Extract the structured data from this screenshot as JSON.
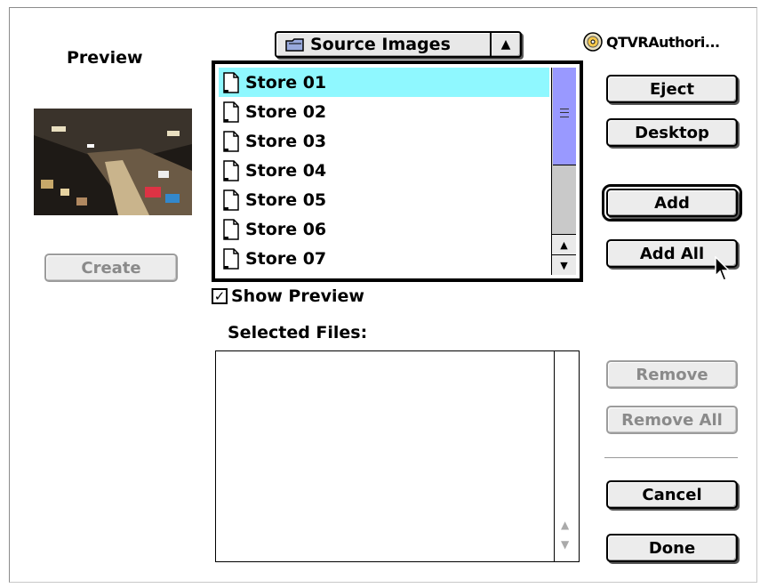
{
  "preview": {
    "title": "Preview"
  },
  "create_button": {
    "label": "Create"
  },
  "popup": {
    "label": "Source Images",
    "icon": "folder-icon"
  },
  "volume": {
    "label": "QTVRAuthori...",
    "icon": "cd-icon"
  },
  "files": [
    {
      "name": "Store 01",
      "selected": true
    },
    {
      "name": "Store 02"
    },
    {
      "name": "Store 03"
    },
    {
      "name": "Store 04"
    },
    {
      "name": "Store 05"
    },
    {
      "name": "Store 06"
    },
    {
      "name": "Store 07"
    }
  ],
  "buttons": {
    "eject": "Eject",
    "desktop": "Desktop",
    "add": "Add",
    "add_all": "Add All",
    "remove": "Remove",
    "remove_all": "Remove All",
    "cancel": "Cancel",
    "done": "Done"
  },
  "show_preview": {
    "label": "Show Preview",
    "checked": true
  },
  "selected_files": {
    "label": "Selected Files:"
  },
  "colors": {
    "selection": "#8ff8ff",
    "scroll_thumb": "#9999ff"
  }
}
